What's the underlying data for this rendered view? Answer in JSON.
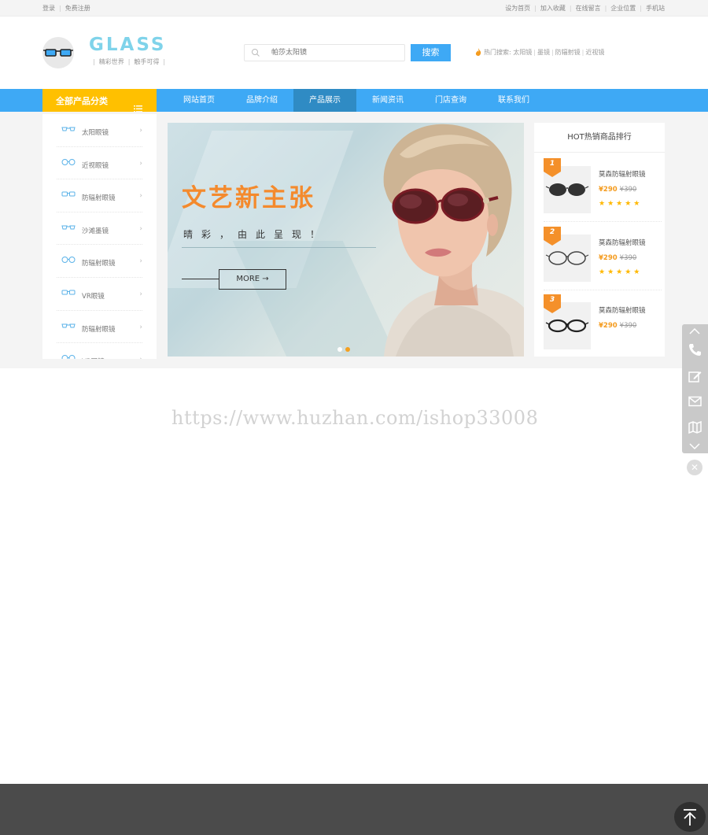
{
  "topbar": {
    "login": "登录",
    "register": "免费注册",
    "links": [
      "设为首页",
      "加入收藏",
      "在线留言",
      "企业位置",
      "手机站"
    ]
  },
  "logo": {
    "text": "GLASS",
    "slogan_1": "精彩世界",
    "slogan_2": "触手可得"
  },
  "search": {
    "placeholder": "帕莎太阳镜",
    "button": "搜索",
    "hot_label": "热门搜索:",
    "hot_links": [
      "太阳镜",
      "墨镜",
      "防辐射镜",
      "近视镜"
    ]
  },
  "nav": {
    "category_title": "全部产品分类",
    "items": [
      "网站首页",
      "品牌介绍",
      "产品展示",
      "新闻资讯",
      "门店查询",
      "联系我们"
    ],
    "active_index": 2
  },
  "sidebar": {
    "items": [
      "太阳眼镜",
      "近视眼镜",
      "防辐射眼镜",
      "沙滩墨镜",
      "防辐射眼镜",
      "VR眼镜",
      "防辐射眼镜",
      "VR眼镜"
    ]
  },
  "banner": {
    "headline": "文艺新主张",
    "subline": "晴彩，由此呈现！",
    "more": "MORE →"
  },
  "hot": {
    "title": "HOT热销商品排行",
    "items": [
      {
        "rank": "1",
        "name": "莫森防辐射眼镜",
        "price": "¥290",
        "old_price": "¥390",
        "stars": "★★★★★"
      },
      {
        "rank": "2",
        "name": "莫森防辐射眼镜",
        "price": "¥290",
        "old_price": "¥390",
        "stars": "★★★★★"
      },
      {
        "rank": "3",
        "name": "莫森防辐射眼镜",
        "price": "¥290",
        "old_price": "¥390",
        "stars": ""
      }
    ]
  },
  "watermark": "https://www.huzhan.com/ishop33008",
  "colors": {
    "primary_blue": "#3ea9f5",
    "active_nav": "#2f8bc4",
    "category_yellow": "#ffc000",
    "accent_orange": "#f48a2d",
    "footer": "#4b4b4b"
  }
}
